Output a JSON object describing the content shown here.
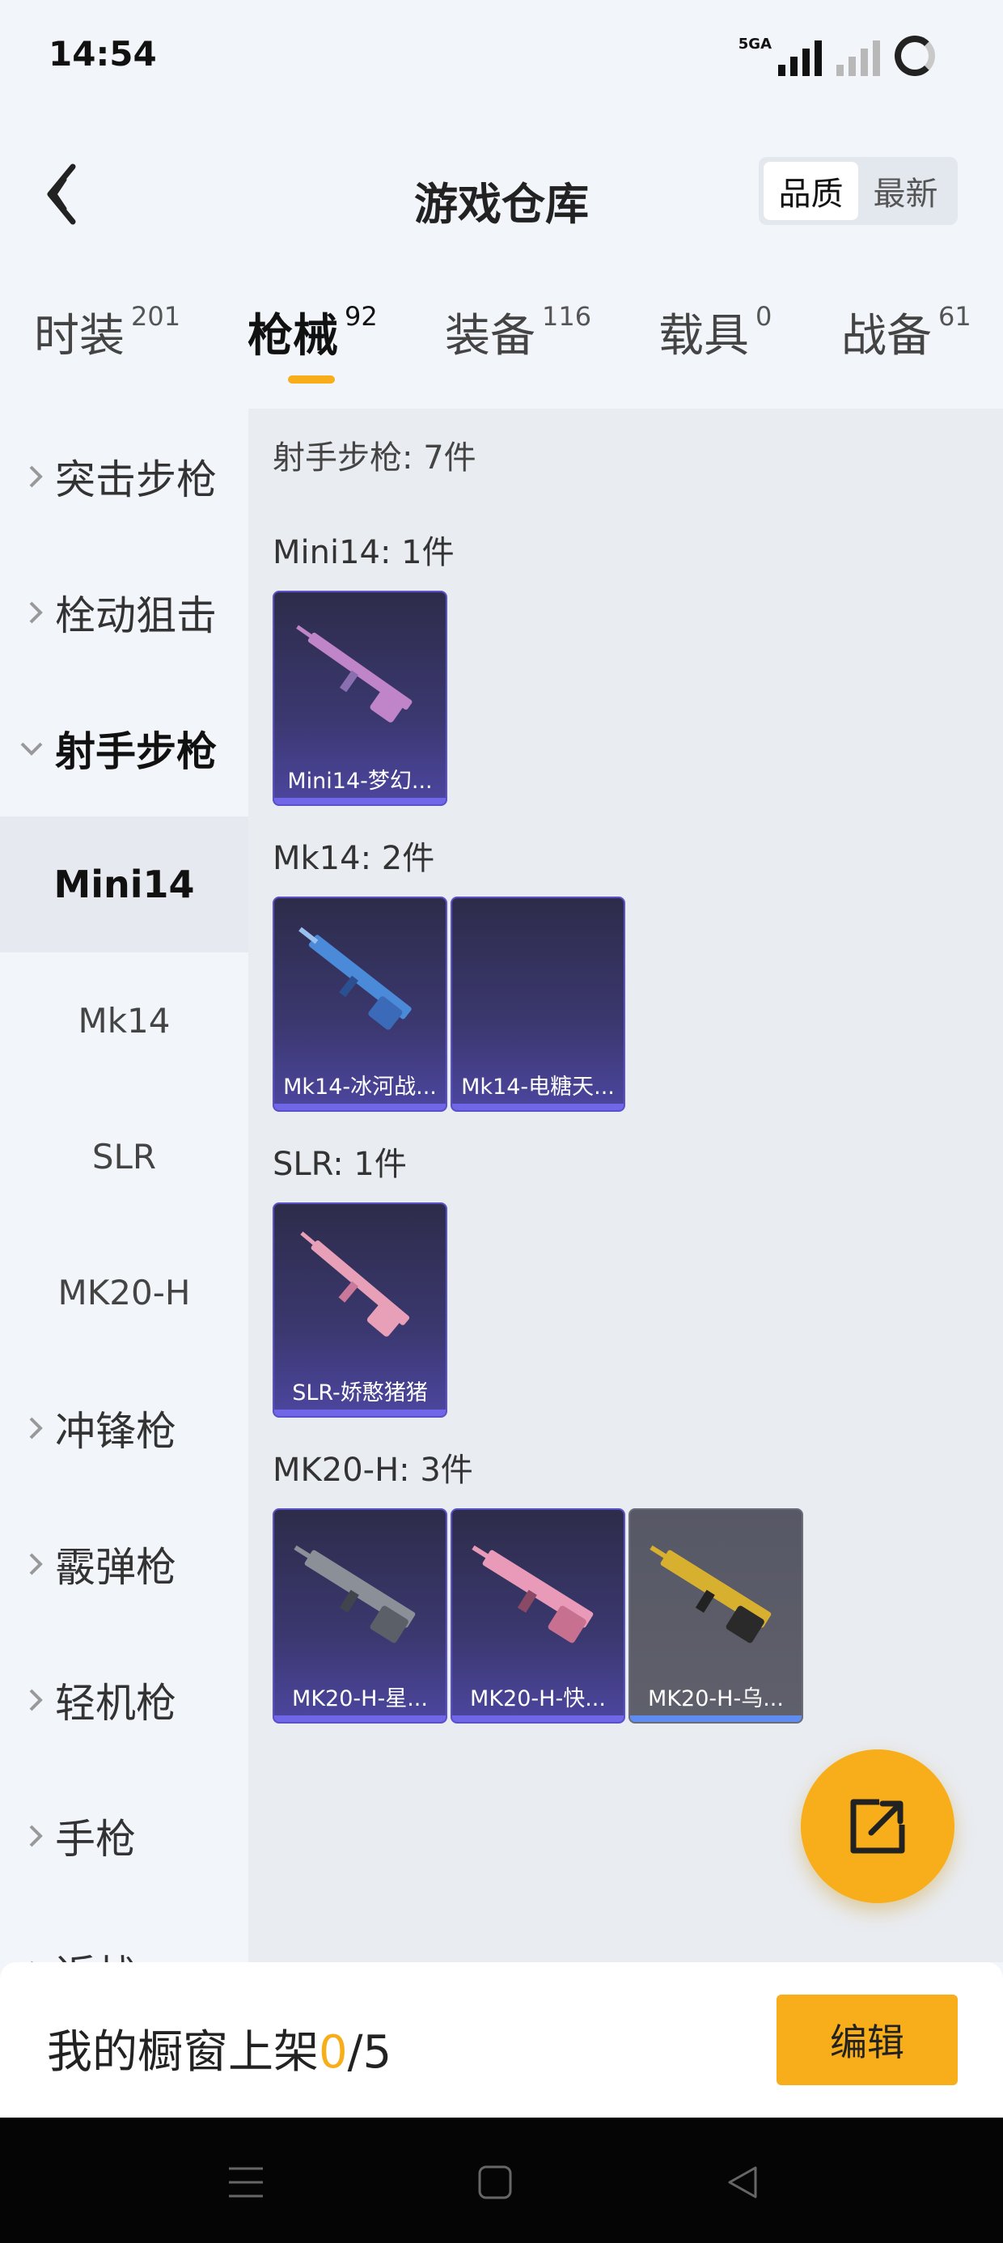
{
  "status": {
    "time": "14:54",
    "network_label": "5GA",
    "icons": [
      "signal-5ga-icon",
      "signal-nosim-icon",
      "battery-ring-icon"
    ]
  },
  "header": {
    "back_icon": "chevron-left-icon",
    "title": "游戏仓库",
    "sort_options": [
      "品质",
      "最新"
    ],
    "sort_selected": "品质"
  },
  "tabs": [
    {
      "label": "时装",
      "count": "201"
    },
    {
      "label": "枪械",
      "count": "92"
    },
    {
      "label": "装备",
      "count": "116"
    },
    {
      "label": "载具",
      "count": "0"
    },
    {
      "label": "战备",
      "count": "61"
    }
  ],
  "active_tab": "枪械",
  "sidebar": {
    "items": [
      {
        "label": "突击步枪",
        "type": "category"
      },
      {
        "label": "栓动狙击",
        "type": "category"
      },
      {
        "label": "射手步枪",
        "type": "category"
      },
      {
        "label": "Mini14",
        "type": "sub"
      },
      {
        "label": "Mk14",
        "type": "sub"
      },
      {
        "label": "SLR",
        "type": "sub"
      },
      {
        "label": "MK20-H",
        "type": "sub"
      },
      {
        "label": "冲锋枪",
        "type": "category"
      },
      {
        "label": "霰弹枪",
        "type": "category"
      },
      {
        "label": "轻机枪",
        "type": "category"
      },
      {
        "label": "手枪",
        "type": "category"
      },
      {
        "label": "近战",
        "type": "category"
      }
    ],
    "expanded": "射手步枪",
    "selected": "Mini14"
  },
  "content": {
    "section_title": "射手步枪: 7件",
    "groups": [
      {
        "title": "Mini14: 1件",
        "items": [
          {
            "name": "Mini14-梦幻...",
            "color": "#c084c8"
          }
        ]
      },
      {
        "title": "Mk14: 2件",
        "items": [
          {
            "name": "Mk14-冰河战...",
            "color": "#4a8ad8"
          },
          {
            "name": "Mk14-电糖天...",
            "color": ""
          }
        ]
      },
      {
        "title": "SLR: 1件",
        "items": [
          {
            "name": "SLR-娇憨猪猪",
            "color": "#e8a0b8"
          }
        ]
      },
      {
        "title": "MK20-H: 3件",
        "items": [
          {
            "name": "MK20-H-星...",
            "color": "#8a8f98"
          },
          {
            "name": "MK20-H-快...",
            "color": "#e89ab8"
          },
          {
            "name": "MK20-H-乌...",
            "color": "#d8b030"
          }
        ]
      }
    ]
  },
  "fab": {
    "icon": "share-external-icon"
  },
  "shelf": {
    "prefix": "我的橱窗上架 ",
    "count": "0",
    "total": "/5"
  },
  "edit_button": "编辑",
  "system_nav": [
    "menu-icon",
    "home-icon",
    "back-icon"
  ],
  "colors": {
    "accent": "#f7ae1a",
    "card_purple": "#4d46a0",
    "card_gray": "#5f606b"
  }
}
